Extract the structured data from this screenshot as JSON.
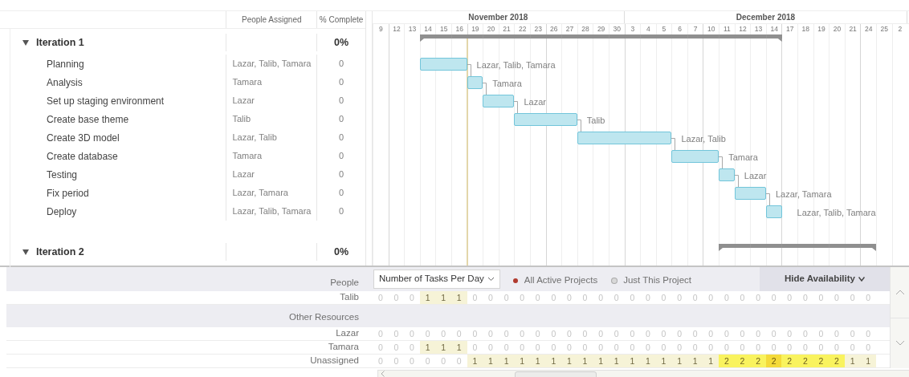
{
  "header": {
    "columns": [
      "People Assigned",
      "% Complete"
    ]
  },
  "months": [
    {
      "label": "November 2018",
      "days": [
        {
          "label": "9",
          "week_start": false,
          "today": false
        },
        {
          "label": "12",
          "week_start": true,
          "today": false
        },
        {
          "label": "13",
          "week_start": false,
          "today": false
        },
        {
          "label": "14",
          "week_start": false,
          "today": false
        },
        {
          "label": "15",
          "week_start": false,
          "today": false
        },
        {
          "label": "16",
          "week_start": false,
          "today": false
        },
        {
          "label": "19",
          "week_start": true,
          "today": true
        },
        {
          "label": "20",
          "week_start": false,
          "today": false
        },
        {
          "label": "21",
          "week_start": false,
          "today": false
        },
        {
          "label": "22",
          "week_start": false,
          "today": false
        },
        {
          "label": "23",
          "week_start": false,
          "today": false
        },
        {
          "label": "26",
          "week_start": true,
          "today": false
        },
        {
          "label": "27",
          "week_start": false,
          "today": false
        },
        {
          "label": "28",
          "week_start": false,
          "today": false
        },
        {
          "label": "29",
          "week_start": false,
          "today": false
        },
        {
          "label": "30",
          "week_start": false,
          "today": false
        }
      ]
    },
    {
      "label": "December 2018",
      "days": [
        {
          "label": "3",
          "week_start": true,
          "today": false
        },
        {
          "label": "4",
          "week_start": false,
          "today": false
        },
        {
          "label": "5",
          "week_start": false,
          "today": false
        },
        {
          "label": "6",
          "week_start": false,
          "today": false
        },
        {
          "label": "7",
          "week_start": false,
          "today": false
        },
        {
          "label": "10",
          "week_start": true,
          "today": false
        },
        {
          "label": "11",
          "week_start": false,
          "today": false
        },
        {
          "label": "12",
          "week_start": false,
          "today": false
        },
        {
          "label": "13",
          "week_start": false,
          "today": false
        },
        {
          "label": "14",
          "week_start": false,
          "today": false
        },
        {
          "label": "17",
          "week_start": true,
          "today": false
        },
        {
          "label": "18",
          "week_start": false,
          "today": false
        },
        {
          "label": "19",
          "week_start": false,
          "today": false
        },
        {
          "label": "20",
          "week_start": false,
          "today": false
        },
        {
          "label": "21",
          "week_start": false,
          "today": false
        },
        {
          "label": "24",
          "week_start": true,
          "today": false
        },
        {
          "label": "25",
          "week_start": false,
          "today": false
        },
        {
          "label": "2",
          "week_start": false,
          "today": false
        }
      ]
    }
  ],
  "groups": [
    {
      "name": "Iteration 1",
      "complete": "0%",
      "expanded": true,
      "schedule": [
        false,
        false,
        false,
        true,
        true,
        true,
        true,
        true,
        true,
        true,
        true,
        true,
        true,
        true,
        true,
        true,
        true,
        true,
        true,
        true,
        true,
        true,
        true,
        true,
        true,
        true
      ],
      "tasks": [
        {
          "name": "Planning",
          "people": "Lazar, Talib, Tamara",
          "complete": "0",
          "label": "Lazar, Talib, Tamara",
          "schedule": [
            false,
            false,
            false,
            true,
            true,
            true
          ]
        },
        {
          "name": "Analysis",
          "people": "Tamara",
          "complete": "0",
          "label": "Tamara",
          "schedule": [
            false,
            false,
            false,
            false,
            false,
            false,
            true
          ]
        },
        {
          "name": "Set up staging environment",
          "people": "Lazar",
          "complete": "0",
          "label": "Lazar",
          "schedule": [
            false,
            false,
            false,
            false,
            false,
            false,
            false,
            true,
            true
          ]
        },
        {
          "name": "Create base theme",
          "people": "Talib",
          "complete": "0",
          "label": "Talib",
          "schedule": [
            false,
            false,
            false,
            false,
            false,
            false,
            false,
            false,
            false,
            true,
            true,
            true,
            true
          ]
        },
        {
          "name": "Create 3D model",
          "people": "Lazar, Talib",
          "complete": "0",
          "label": "Lazar, Talib",
          "schedule": [
            false,
            false,
            false,
            false,
            false,
            false,
            false,
            false,
            false,
            false,
            false,
            false,
            false,
            true,
            true,
            true,
            true,
            true,
            true
          ]
        },
        {
          "name": "Create database",
          "people": "Tamara",
          "complete": "0",
          "label": "Tamara",
          "schedule": [
            false,
            false,
            false,
            false,
            false,
            false,
            false,
            false,
            false,
            false,
            false,
            false,
            false,
            false,
            false,
            false,
            false,
            false,
            false,
            true,
            true,
            true
          ]
        },
        {
          "name": "Testing",
          "people": "Lazar",
          "complete": "0",
          "label": "Lazar",
          "schedule": [
            false,
            false,
            false,
            false,
            false,
            false,
            false,
            false,
            false,
            false,
            false,
            false,
            false,
            false,
            false,
            false,
            false,
            false,
            false,
            false,
            false,
            false,
            true
          ]
        },
        {
          "name": "Fix period",
          "people": "Lazar, Tamara",
          "complete": "0",
          "label": "Lazar, Tamara",
          "schedule": [
            false,
            false,
            false,
            false,
            false,
            false,
            false,
            false,
            false,
            false,
            false,
            false,
            false,
            false,
            false,
            false,
            false,
            false,
            false,
            false,
            false,
            false,
            false,
            true,
            true
          ]
        },
        {
          "name": "Deploy",
          "people": "Lazar, Talib, Tamara",
          "complete": "0",
          "label": "Lazar, Talib, Tamara",
          "schedule": [
            false,
            false,
            false,
            false,
            false,
            false,
            false,
            false,
            false,
            false,
            false,
            false,
            false,
            false,
            false,
            false,
            false,
            false,
            false,
            false,
            false,
            false,
            false,
            false,
            false,
            true
          ]
        }
      ]
    },
    {
      "name": "Iteration 2",
      "complete": "0%",
      "expanded": true,
      "schedule": [
        false,
        false,
        false,
        false,
        false,
        false,
        false,
        false,
        false,
        false,
        false,
        false,
        false,
        false,
        false,
        false,
        false,
        false,
        false,
        false,
        false,
        false,
        true,
        true,
        true,
        true,
        true,
        true,
        true,
        true,
        true,
        true
      ]
    }
  ],
  "availability": {
    "view_select": "Number of Tasks Per Day",
    "scopes": [
      {
        "label": "All Active Projects",
        "selected": true
      },
      {
        "label": "Just This Project",
        "selected": false
      }
    ],
    "hide_button": "Hide Availability",
    "sections": [
      {
        "title": "People",
        "rows": [
          {
            "name": "Talib",
            "cells": [
              {
                "value": "0",
                "kind": "none"
              },
              {
                "value": "0",
                "kind": "none"
              },
              {
                "value": "0",
                "kind": "none"
              },
              {
                "value": "1",
                "kind": "low"
              },
              {
                "value": "1",
                "kind": "low"
              },
              {
                "value": "1",
                "kind": "low"
              },
              {
                "value": "0",
                "kind": "none"
              },
              {
                "value": "0",
                "kind": "none"
              },
              {
                "value": "0",
                "kind": "none"
              },
              {
                "value": "0",
                "kind": "none"
              },
              {
                "value": "0",
                "kind": "none"
              },
              {
                "value": "0",
                "kind": "none"
              },
              {
                "value": "0",
                "kind": "none"
              },
              {
                "value": "0",
                "kind": "none"
              },
              {
                "value": "0",
                "kind": "none"
              },
              {
                "value": "0",
                "kind": "none"
              },
              {
                "value": "0",
                "kind": "none"
              },
              {
                "value": "0",
                "kind": "none"
              },
              {
                "value": "0",
                "kind": "none"
              },
              {
                "value": "0",
                "kind": "none"
              },
              {
                "value": "0",
                "kind": "none"
              },
              {
                "value": "0",
                "kind": "none"
              },
              {
                "value": "0",
                "kind": "none"
              },
              {
                "value": "0",
                "kind": "none"
              },
              {
                "value": "0",
                "kind": "none"
              },
              {
                "value": "0",
                "kind": "none"
              },
              {
                "value": "0",
                "kind": "none"
              },
              {
                "value": "0",
                "kind": "none"
              },
              {
                "value": "0",
                "kind": "none"
              },
              {
                "value": "0",
                "kind": "none"
              },
              {
                "value": "0",
                "kind": "none"
              },
              {
                "value": "0",
                "kind": "none"
              }
            ]
          }
        ]
      },
      {
        "title": "Other Resources",
        "rows": [
          {
            "name": "Lazar",
            "cells": [
              {
                "value": "0",
                "kind": "none"
              },
              {
                "value": "0",
                "kind": "none"
              },
              {
                "value": "0",
                "kind": "none"
              },
              {
                "value": "0",
                "kind": "none"
              },
              {
                "value": "0",
                "kind": "none"
              },
              {
                "value": "0",
                "kind": "none"
              },
              {
                "value": "0",
                "kind": "none"
              },
              {
                "value": "0",
                "kind": "none"
              },
              {
                "value": "0",
                "kind": "none"
              },
              {
                "value": "0",
                "kind": "none"
              },
              {
                "value": "0",
                "kind": "none"
              },
              {
                "value": "0",
                "kind": "none"
              },
              {
                "value": "0",
                "kind": "none"
              },
              {
                "value": "0",
                "kind": "none"
              },
              {
                "value": "0",
                "kind": "none"
              },
              {
                "value": "0",
                "kind": "none"
              },
              {
                "value": "0",
                "kind": "none"
              },
              {
                "value": "0",
                "kind": "none"
              },
              {
                "value": "0",
                "kind": "none"
              },
              {
                "value": "0",
                "kind": "none"
              },
              {
                "value": "0",
                "kind": "none"
              },
              {
                "value": "0",
                "kind": "none"
              },
              {
                "value": "0",
                "kind": "none"
              },
              {
                "value": "0",
                "kind": "none"
              },
              {
                "value": "0",
                "kind": "none"
              },
              {
                "value": "0",
                "kind": "none"
              },
              {
                "value": "0",
                "kind": "none"
              },
              {
                "value": "0",
                "kind": "none"
              },
              {
                "value": "0",
                "kind": "none"
              },
              {
                "value": "0",
                "kind": "none"
              },
              {
                "value": "0",
                "kind": "none"
              },
              {
                "value": "0",
                "kind": "none"
              }
            ]
          },
          {
            "name": "Tamara",
            "cells": [
              {
                "value": "0",
                "kind": "none"
              },
              {
                "value": "0",
                "kind": "none"
              },
              {
                "value": "0",
                "kind": "none"
              },
              {
                "value": "1",
                "kind": "low"
              },
              {
                "value": "1",
                "kind": "low"
              },
              {
                "value": "1",
                "kind": "low"
              },
              {
                "value": "0",
                "kind": "none"
              },
              {
                "value": "0",
                "kind": "none"
              },
              {
                "value": "0",
                "kind": "none"
              },
              {
                "value": "0",
                "kind": "none"
              },
              {
                "value": "0",
                "kind": "none"
              },
              {
                "value": "0",
                "kind": "none"
              },
              {
                "value": "0",
                "kind": "none"
              },
              {
                "value": "0",
                "kind": "none"
              },
              {
                "value": "0",
                "kind": "none"
              },
              {
                "value": "0",
                "kind": "none"
              },
              {
                "value": "0",
                "kind": "none"
              },
              {
                "value": "0",
                "kind": "none"
              },
              {
                "value": "0",
                "kind": "none"
              },
              {
                "value": "0",
                "kind": "none"
              },
              {
                "value": "0",
                "kind": "none"
              },
              {
                "value": "0",
                "kind": "none"
              },
              {
                "value": "0",
                "kind": "none"
              },
              {
                "value": "0",
                "kind": "none"
              },
              {
                "value": "0",
                "kind": "none"
              },
              {
                "value": "0",
                "kind": "none"
              },
              {
                "value": "0",
                "kind": "none"
              },
              {
                "value": "0",
                "kind": "none"
              },
              {
                "value": "0",
                "kind": "none"
              },
              {
                "value": "0",
                "kind": "none"
              },
              {
                "value": "0",
                "kind": "none"
              },
              {
                "value": "0",
                "kind": "none"
              }
            ]
          },
          {
            "name": "Unassigned",
            "cells": [
              {
                "value": "0",
                "kind": "none"
              },
              {
                "value": "0",
                "kind": "none"
              },
              {
                "value": "0",
                "kind": "none"
              },
              {
                "value": "0",
                "kind": "none"
              },
              {
                "value": "0",
                "kind": "none"
              },
              {
                "value": "0",
                "kind": "none"
              },
              {
                "value": "1",
                "kind": "low"
              },
              {
                "value": "1",
                "kind": "low"
              },
              {
                "value": "1",
                "kind": "low"
              },
              {
                "value": "1",
                "kind": "low"
              },
              {
                "value": "1",
                "kind": "low"
              },
              {
                "value": "1",
                "kind": "low"
              },
              {
                "value": "1",
                "kind": "low"
              },
              {
                "value": "1",
                "kind": "low"
              },
              {
                "value": "1",
                "kind": "low"
              },
              {
                "value": "1",
                "kind": "low"
              },
              {
                "value": "1",
                "kind": "low"
              },
              {
                "value": "1",
                "kind": "low"
              },
              {
                "value": "1",
                "kind": "low"
              },
              {
                "value": "1",
                "kind": "low"
              },
              {
                "value": "1",
                "kind": "low"
              },
              {
                "value": "1",
                "kind": "low"
              },
              {
                "value": "2",
                "kind": "high"
              },
              {
                "value": "2",
                "kind": "high"
              },
              {
                "value": "2",
                "kind": "high"
              },
              {
                "value": "2",
                "kind": "peak"
              },
              {
                "value": "2",
                "kind": "high"
              },
              {
                "value": "2",
                "kind": "high"
              },
              {
                "value": "2",
                "kind": "high"
              },
              {
                "value": "2",
                "kind": "high"
              },
              {
                "value": "1",
                "kind": "low"
              },
              {
                "value": "1",
                "kind": "low"
              }
            ]
          }
        ]
      }
    ]
  }
}
